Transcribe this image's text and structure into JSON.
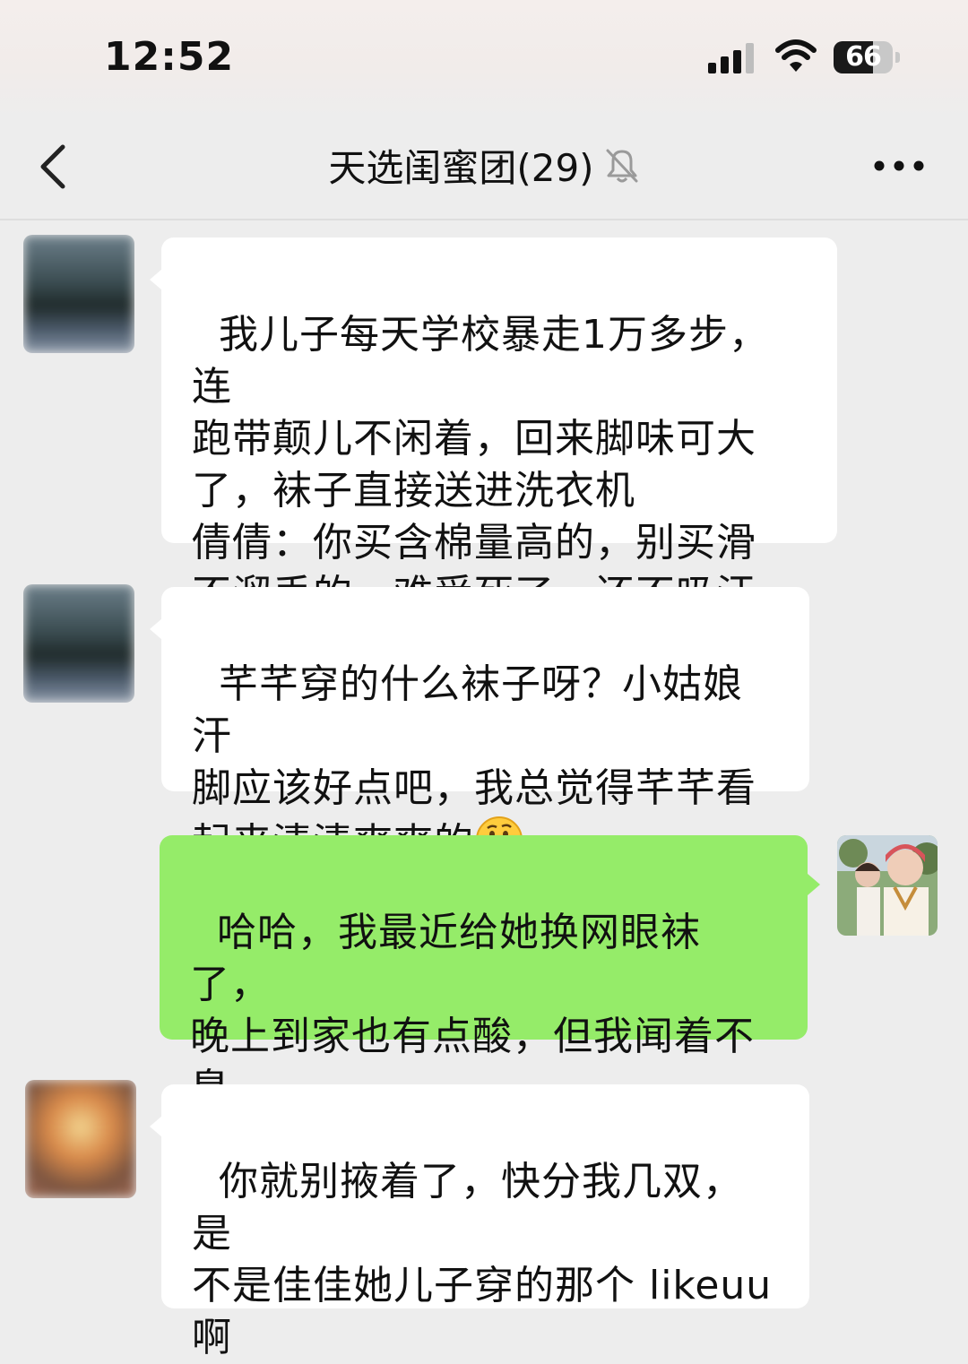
{
  "status_bar": {
    "time": "12:52",
    "battery_level": "66",
    "battery_fraction": 0.66
  },
  "nav": {
    "title": "天选闺蜜团(29)",
    "back_icon": "chevron-left-icon",
    "mute_icon": "bell-muted-icon",
    "more_icon": "more-dots-icon"
  },
  "messages": [
    {
      "side": "in",
      "avatar": "blurred",
      "text": "我儿子每天学校暴走1万多步，连\n跑带颠儿不闲着，回来脚味可大\n了，袜子直接送进洗衣机\n倩倩：你买含棉量高的，别买滑\n不溜丢的，难受死了，还不吸汗"
    },
    {
      "side": "in",
      "avatar": "blurred",
      "text": "芊芊穿的什么袜子呀？小姑娘汗\n脚应该好点吧，我总觉得芊芊看\n起来清清爽爽的",
      "emoji": "thinking-face-emoji"
    },
    {
      "side": "out",
      "avatar": "photo",
      "text": "哈哈，我最近给她换网眼袜了，\n晚上到家也有点酸，但我闻着不\n臭"
    },
    {
      "side": "in",
      "avatar": "blurred",
      "text": "你就别掖着了，快分我几双，是\n不是佳佳她儿子穿的那个 likeuu\n啊"
    }
  ],
  "colors": {
    "background": "#ededed",
    "bubble_in": "#ffffff",
    "bubble_out": "#95ec69"
  }
}
